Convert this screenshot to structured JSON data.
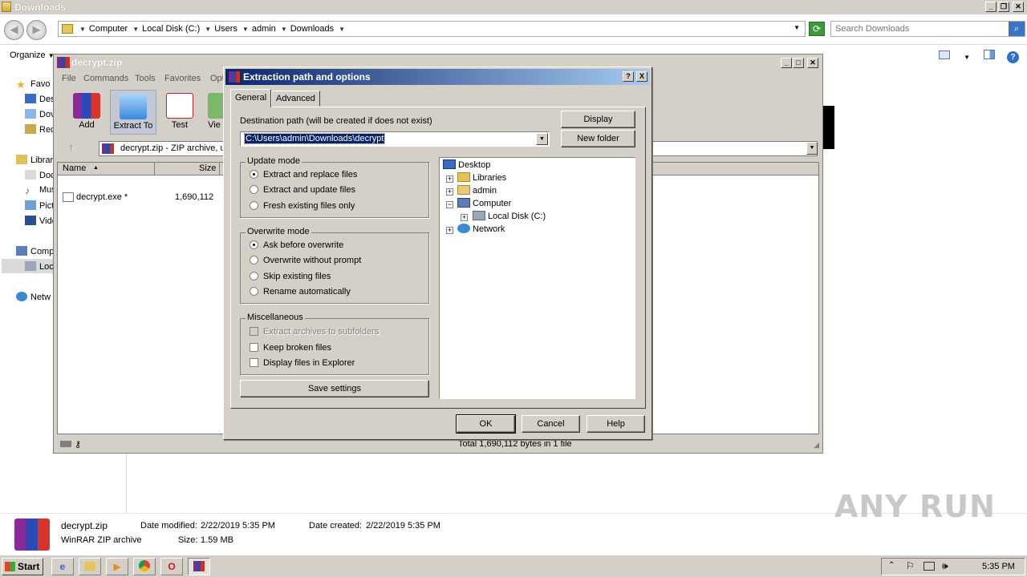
{
  "explorer": {
    "title": "Downloads",
    "breadcrumb": [
      "Computer",
      "Local Disk (C:)",
      "Users",
      "admin",
      "Downloads"
    ],
    "search_placeholder": "Search Downloads",
    "organize": "Organize",
    "nav_items": [
      "Favo",
      "Des",
      "Dov",
      "Rec",
      "Librar",
      "Doc",
      "Mus",
      "Pict",
      "Vide",
      "Comp",
      "Loc",
      "Netw"
    ]
  },
  "details": {
    "file_name": "decrypt.zip",
    "file_type": "WinRAR ZIP archive",
    "date_modified_label": "Date modified:",
    "date_modified": "2/22/2019 5:35 PM",
    "size_label": "Size:",
    "size": "1.59 MB",
    "date_created_label": "Date created:",
    "date_created": "2/22/2019 5:35 PM"
  },
  "winrar": {
    "title": "decrypt.zip",
    "menu": [
      "File",
      "Commands",
      "Tools",
      "Favorites",
      "Opt"
    ],
    "tools": [
      "Add",
      "Extract To",
      "Test",
      "Vie"
    ],
    "path_text": "decrypt.zip - ZIP archive, u",
    "columns": {
      "name": "Name",
      "size": "Size"
    },
    "files": [
      {
        "name": "decrypt.exe *",
        "size": "1,690,112"
      }
    ],
    "status_total": "Total 1,690,112 bytes in 1 file"
  },
  "dialog": {
    "title": "Extraction path and options",
    "help_btn": "?",
    "close_btn": "X",
    "tabs": [
      "General",
      "Advanced"
    ],
    "dest_label": "Destination path (will be created if does not exist)",
    "dest_value": "C:\\Users\\admin\\Downloads\\decrypt",
    "display_btn": "Display",
    "new_folder_btn": "New folder",
    "update_mode": {
      "label": "Update mode",
      "options": [
        "Extract and replace files",
        "Extract and update files",
        "Fresh existing files only"
      ],
      "selected": 0
    },
    "overwrite_mode": {
      "label": "Overwrite mode",
      "options": [
        "Ask before overwrite",
        "Overwrite without prompt",
        "Skip existing files",
        "Rename automatically"
      ],
      "selected": 0
    },
    "misc": {
      "label": "Miscellaneous",
      "options": [
        "Extract archives to subfolders",
        "Keep broken files",
        "Display files in Explorer"
      ]
    },
    "save_settings_btn": "Save settings",
    "tree": [
      "Desktop",
      "Libraries",
      "admin",
      "Computer",
      "Local Disk (C:)",
      "Network"
    ],
    "ok_btn": "OK",
    "cancel_btn": "Cancel",
    "help_button": "Help"
  },
  "taskbar": {
    "start": "Start",
    "clock": "5:35 PM"
  },
  "watermark": "ANY RUN"
}
